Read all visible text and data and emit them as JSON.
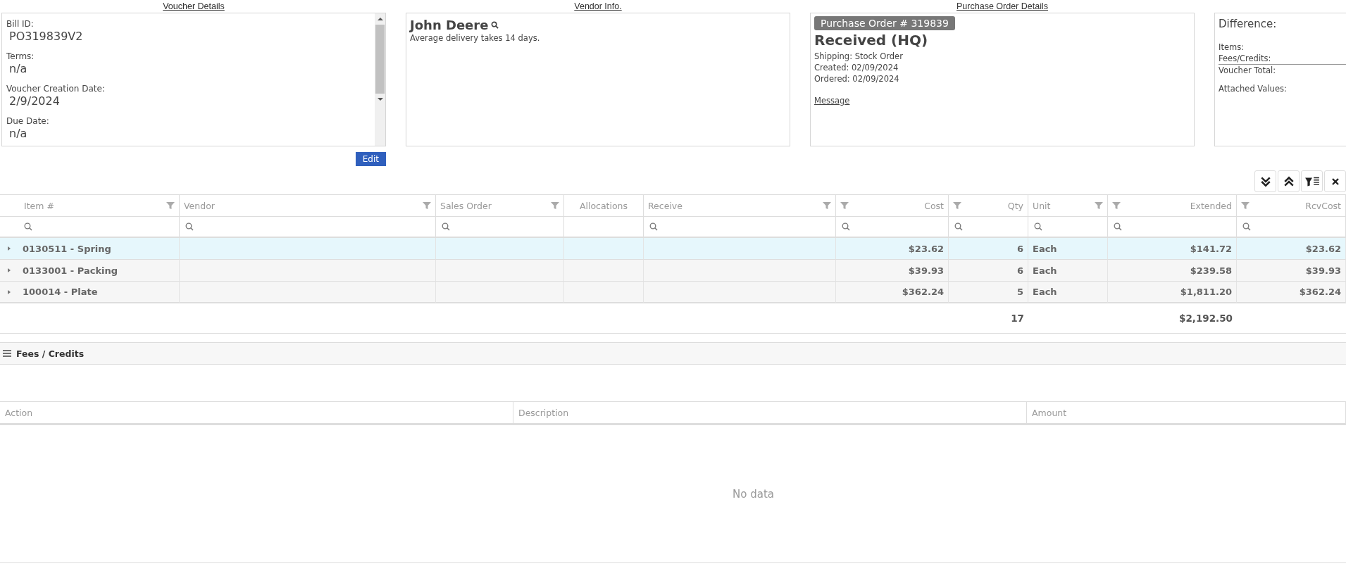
{
  "voucher": {
    "heading": "Voucher Details",
    "fields": [
      {
        "label": "Bill ID:",
        "value": "PO319839V2"
      },
      {
        "label": "Terms:",
        "value": "n/a"
      },
      {
        "label": "Voucher Creation Date:",
        "value": "2/9/2024"
      },
      {
        "label": "Due Date:",
        "value": "n/a"
      }
    ],
    "edit_button": "Edit"
  },
  "vendor": {
    "heading": "Vendor Info.",
    "name": "John Deere",
    "note": "Average delivery takes 14 days."
  },
  "purchase_order": {
    "heading": "Purchase Order Details",
    "badge": "Purchase Order # 319839",
    "status": "Received (HQ)",
    "lines": [
      "Shipping: Stock Order",
      "Created: 02/09/2024",
      "Ordered: 02/09/2024"
    ],
    "link": "Message"
  },
  "difference": {
    "title": "Difference:",
    "lines": [
      "Items:",
      "Fees/Credits:",
      "Voucher Total:",
      "Attached Values:"
    ]
  },
  "items_table": {
    "columns": [
      {
        "label": "Item #",
        "kind": "text"
      },
      {
        "label": "Vendor",
        "kind": "text"
      },
      {
        "label": "Sales Order",
        "kind": "text"
      },
      {
        "label": "Allocations",
        "kind": "plain"
      },
      {
        "label": "Receive",
        "kind": "text"
      },
      {
        "label": "Cost",
        "kind": "number"
      },
      {
        "label": "Qty",
        "kind": "number"
      },
      {
        "label": "Unit",
        "kind": "text"
      },
      {
        "label": "Extended",
        "kind": "number"
      },
      {
        "label": "RcvCost",
        "kind": "number"
      }
    ],
    "rows": [
      {
        "item": "0130511 - Spring",
        "cost": "$23.62",
        "qty": "6",
        "unit": "Each",
        "extended": "$141.72",
        "rcv_cost": "$23.62",
        "selected": true
      },
      {
        "item": "0133001 - Packing",
        "cost": "$39.93",
        "qty": "6",
        "unit": "Each",
        "extended": "$239.58",
        "rcv_cost": "$39.93",
        "selected": false
      },
      {
        "item": "100014 - Plate",
        "cost": "$362.24",
        "qty": "5",
        "unit": "Each",
        "extended": "$1,811.20",
        "rcv_cost": "$362.24",
        "selected": false
      }
    ],
    "totals": {
      "qty": "17",
      "extended": "$2,192.50"
    }
  },
  "fees": {
    "title": "Fees / Credits",
    "columns": [
      "Action",
      "Description",
      "Amount"
    ],
    "empty_text": "No data"
  }
}
